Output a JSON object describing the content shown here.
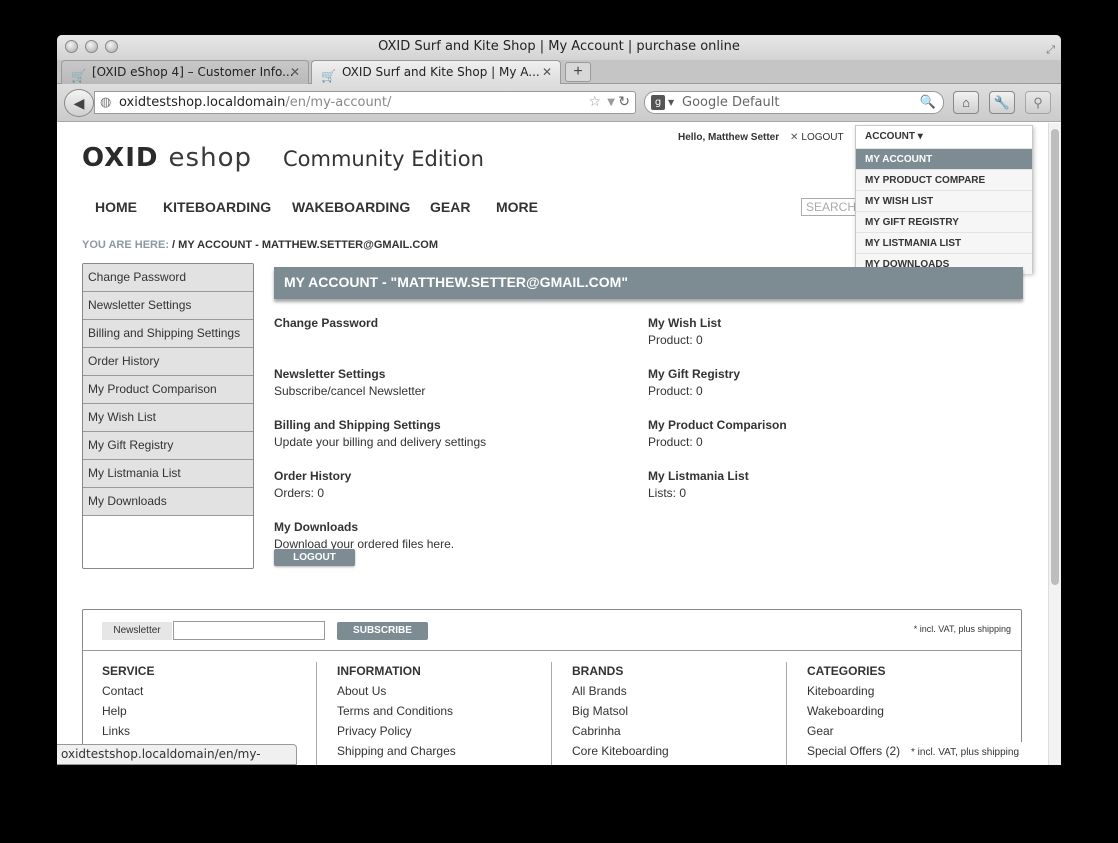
{
  "window": {
    "title": "OXID Surf and Kite Shop | My Account | purchase online"
  },
  "tabs": [
    {
      "label": "[OXID eShop 4] – Customer Info..."
    },
    {
      "label": "OXID Surf and Kite Shop | My A..."
    }
  ],
  "newtab_label": "+",
  "address": {
    "host": "oxidtestshop.localdomain",
    "path": "/en/my-account/"
  },
  "search_engine": {
    "placeholder": "Google Default"
  },
  "header": {
    "logo_main": "OXID",
    "logo_sub": "eshop",
    "edition": "Community Edition",
    "greeting": "Hello, Matthew Setter",
    "logout": "LOGOUT",
    "search_placeholder": "SEARCH"
  },
  "account_menu": {
    "title": "ACCOUNT",
    "items": [
      {
        "label": "MY ACCOUNT"
      },
      {
        "label": "MY PRODUCT COMPARE"
      },
      {
        "label": "MY WISH LIST"
      },
      {
        "label": "MY GIFT REGISTRY"
      },
      {
        "label": "MY LISTMANIA LIST"
      },
      {
        "label": "MY DOWNLOADS"
      }
    ]
  },
  "nav": [
    {
      "label": "HOME"
    },
    {
      "label": "KITEBOARDING"
    },
    {
      "label": "WAKEBOARDING"
    },
    {
      "label": "GEAR"
    },
    {
      "label": "MORE"
    }
  ],
  "breadcrumb": {
    "label": "YOU ARE HERE:",
    "path": " / MY ACCOUNT - MATTHEW.SETTER@GMAIL.COM"
  },
  "sidebar": [
    {
      "label": "Change Password"
    },
    {
      "label": "Newsletter Settings"
    },
    {
      "label": "Billing and Shipping Settings"
    },
    {
      "label": "Order History"
    },
    {
      "label": "My Product Comparison"
    },
    {
      "label": "My Wish List"
    },
    {
      "label": "My Gift Registry"
    },
    {
      "label": "My Listmania List"
    },
    {
      "label": "My Downloads"
    }
  ],
  "content": {
    "heading": "MY ACCOUNT - \"MATTHEW.SETTER@GMAIL.COM\"",
    "left": [
      {
        "title": "Change Password",
        "desc": ""
      },
      {
        "title": "Newsletter Settings",
        "desc": "Subscribe/cancel Newsletter"
      },
      {
        "title": "Billing and Shipping Settings",
        "desc": "Update your billing and delivery settings"
      },
      {
        "title": "Order History",
        "desc": "Orders: 0"
      },
      {
        "title": "My Downloads",
        "desc": "Download your ordered files here."
      }
    ],
    "right": [
      {
        "title": "My Wish List",
        "desc": "Product: 0"
      },
      {
        "title": "My Gift Registry",
        "desc": "Product: 0"
      },
      {
        "title": "My Product Comparison",
        "desc": "Product: 0"
      },
      {
        "title": "My Listmania List",
        "desc": "Lists: 0"
      }
    ],
    "logout_button": "LOGOUT"
  },
  "footer": {
    "newsletter_label": "Newsletter",
    "subscribe": "SUBSCRIBE",
    "vat_note": "* incl. VAT, plus shipping",
    "columns": [
      {
        "heading": "SERVICE",
        "links": [
          "Contact",
          "Help",
          "Links"
        ]
      },
      {
        "heading": "INFORMATION",
        "links": [
          "About Us",
          "Terms and Conditions",
          "Privacy Policy",
          "Shipping and Charges"
        ]
      },
      {
        "heading": "BRANDS",
        "links": [
          "All Brands",
          "Big Matsol",
          "Cabrinha",
          "Core Kiteboarding"
        ]
      },
      {
        "heading": "CATEGORIES",
        "links": [
          "Kiteboarding",
          "Wakeboarding",
          "Gear",
          "Special Offers (2)"
        ]
      }
    ]
  },
  "status_url": "oxidtestshop.localdomain/en/my-account/",
  "vat_tooltip": "* incl. VAT, plus shipping",
  "colors": {
    "accent": "#7c8c92",
    "breadcrumb_label": "#8a9aa0"
  }
}
